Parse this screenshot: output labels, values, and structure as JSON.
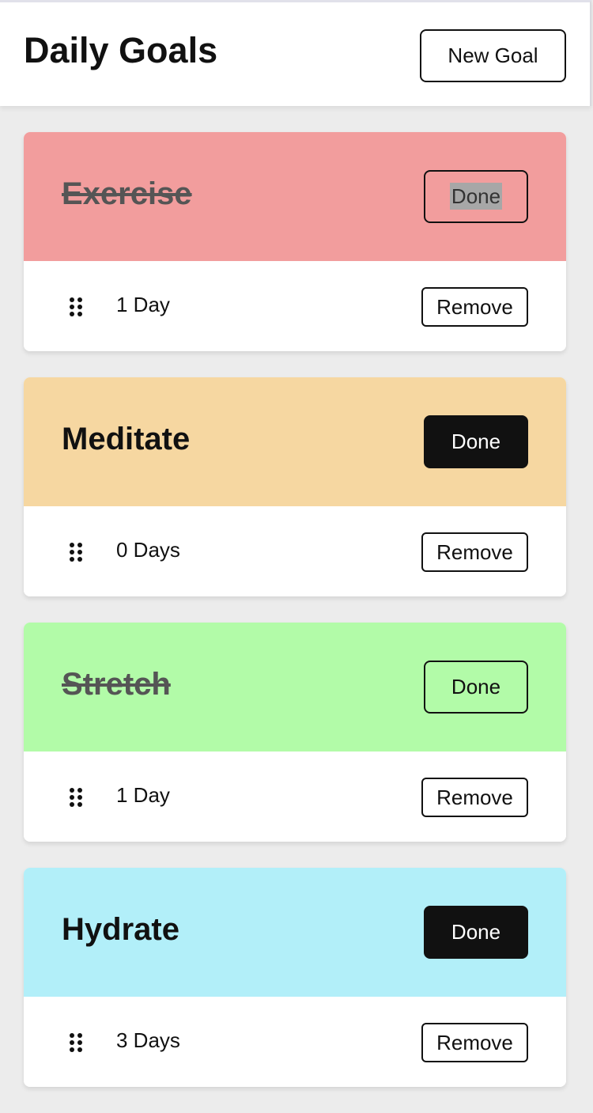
{
  "header": {
    "title": "Daily Goals",
    "new_goal_label": "New Goal"
  },
  "goals": [
    {
      "title": "Exercise",
      "completed": true,
      "card_color": "#f29d9d",
      "done_label": "Done",
      "done_style": "outline-highlight",
      "streak": "1 Day",
      "remove_label": "Remove",
      "drag_icon": "drag-handle-icon"
    },
    {
      "title": "Meditate",
      "completed": false,
      "card_color": "#f6d7a1",
      "done_label": "Done",
      "done_style": "filled",
      "streak": "0 Days",
      "remove_label": "Remove",
      "drag_icon": "drag-handle-icon"
    },
    {
      "title": "Stretch",
      "completed": true,
      "card_color": "#b2fba8",
      "done_label": "Done",
      "done_style": "outline",
      "streak": "1 Day",
      "remove_label": "Remove",
      "drag_icon": "drag-handle-icon"
    },
    {
      "title": "Hydrate",
      "completed": false,
      "card_color": "#b2eff9",
      "done_label": "Done",
      "done_style": "filled",
      "streak": "3 Days",
      "remove_label": "Remove",
      "drag_icon": "drag-handle-icon"
    }
  ],
  "colors": {
    "page_background": "#ececec",
    "header_background": "#ffffff",
    "primary_text": "#111111",
    "completed_text": "#555555",
    "active_button": "#111111"
  }
}
